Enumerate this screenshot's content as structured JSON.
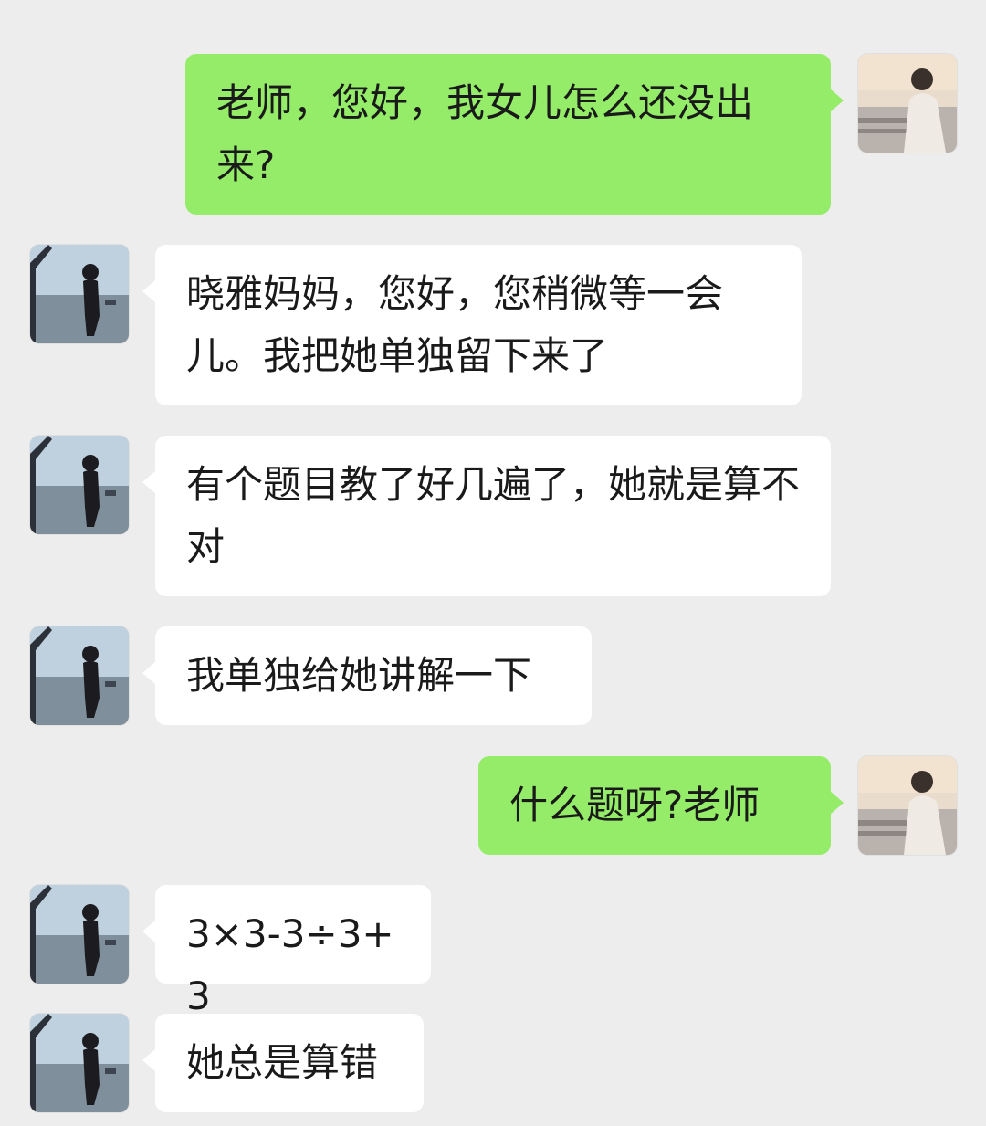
{
  "chat": {
    "messages": [
      {
        "sender": "parent",
        "text": "老师，您好，我女儿怎么还没出来?"
      },
      {
        "sender": "teacher",
        "text": "晓雅妈妈，您好，您稍微等一会儿。我把她单独留下来了"
      },
      {
        "sender": "teacher",
        "text": "有个题目教了好几遍了，她就是算不对"
      },
      {
        "sender": "teacher",
        "text": "我单独给她讲解一下"
      },
      {
        "sender": "parent",
        "text": "什么题呀?老师"
      },
      {
        "sender": "teacher",
        "text": "3×3-3÷3+3"
      },
      {
        "sender": "teacher",
        "text": "她总是算错"
      }
    ]
  },
  "colors": {
    "outgoing_bubble": "#95ec69",
    "incoming_bubble": "#ffffff",
    "background": "#ededed"
  },
  "icons": {
    "parent_avatar": "woman-sunset-avatar",
    "teacher_avatar": "woman-beach-avatar"
  }
}
